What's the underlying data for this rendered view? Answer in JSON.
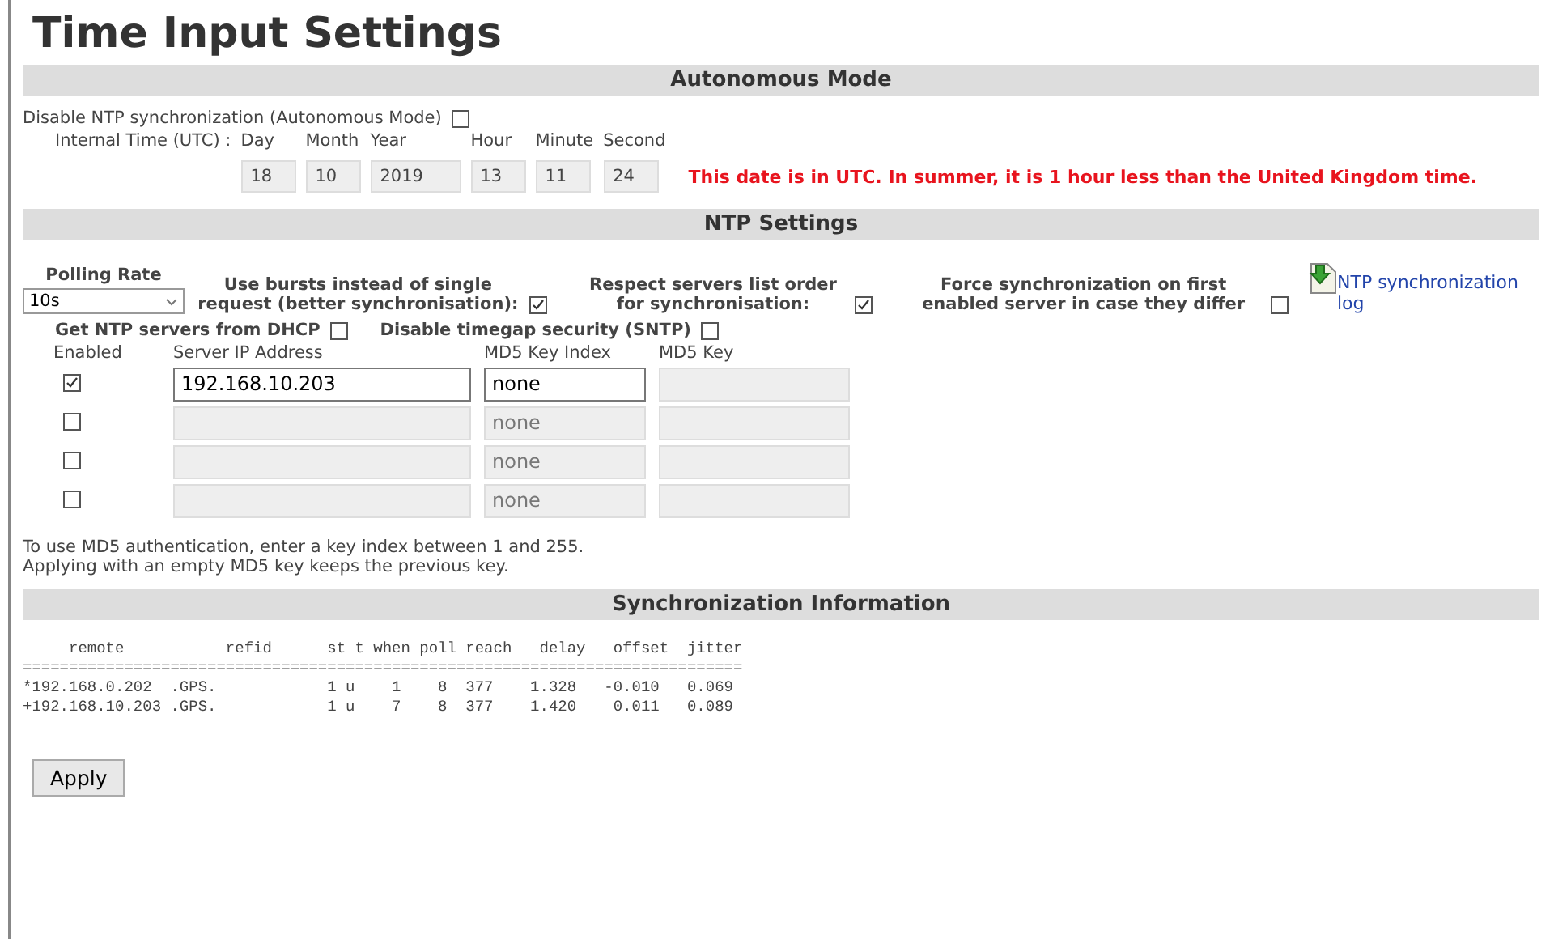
{
  "title": "Time Input Settings",
  "autonomous": {
    "heading": "Autonomous Mode",
    "disable_label": "Disable NTP synchronization (Autonomous Mode)",
    "disable_checked": false,
    "time_label": "Internal Time (UTC) :",
    "fields": [
      {
        "label": "Day",
        "value": "18"
      },
      {
        "label": "Month",
        "value": "10"
      },
      {
        "label": "Year",
        "value": "2019"
      },
      {
        "label": "Hour",
        "value": "13"
      },
      {
        "label": "Minute",
        "value": "11"
      },
      {
        "label": "Second",
        "value": "24"
      }
    ],
    "warning": "This date is in UTC. In summer, it is 1 hour less than the United Kingdom time."
  },
  "ntp": {
    "heading": "NTP Settings",
    "polling_label": "Polling Rate",
    "polling_value": "10s",
    "options": [
      {
        "label": "Use bursts instead of single request (better synchronisation):",
        "checked": true
      },
      {
        "label": "Respect servers list order for synchronisation:",
        "checked": true
      },
      {
        "label": "Force synchronization on first enabled server in case they differ",
        "checked": false
      }
    ],
    "log_link": "NTP synchronization log",
    "options2": [
      {
        "label": "Get NTP servers from DHCP",
        "checked": false
      },
      {
        "label": "Disable timegap security (SNTP)",
        "checked": false
      }
    ],
    "columns": [
      "Enabled",
      "Server IP Address",
      "MD5 Key Index",
      "MD5 Key"
    ],
    "servers": [
      {
        "enabled": true,
        "ip": "192.168.10.203",
        "key_index": "none"
      },
      {
        "enabled": false,
        "key_index": "none"
      },
      {
        "enabled": false,
        "key_index": "none"
      },
      {
        "enabled": false,
        "key_index": "none"
      }
    ],
    "notes": [
      "To use MD5 authentication, enter a key index between 1 and 255.",
      "Applying with an empty MD5 key keeps the previous key."
    ]
  },
  "sync": {
    "heading": "Synchronization Information",
    "lines": [
      "     remote           refid      st t when poll reach   delay   offset  jitter",
      "==============================================================================",
      "*192.168.0.202  .GPS.            1 u    1    8  377    1.328   -0.010   0.069",
      "+192.168.10.203 .GPS.            1 u    7    8  377    1.420    0.011   0.089"
    ]
  },
  "apply_button": "Apply"
}
